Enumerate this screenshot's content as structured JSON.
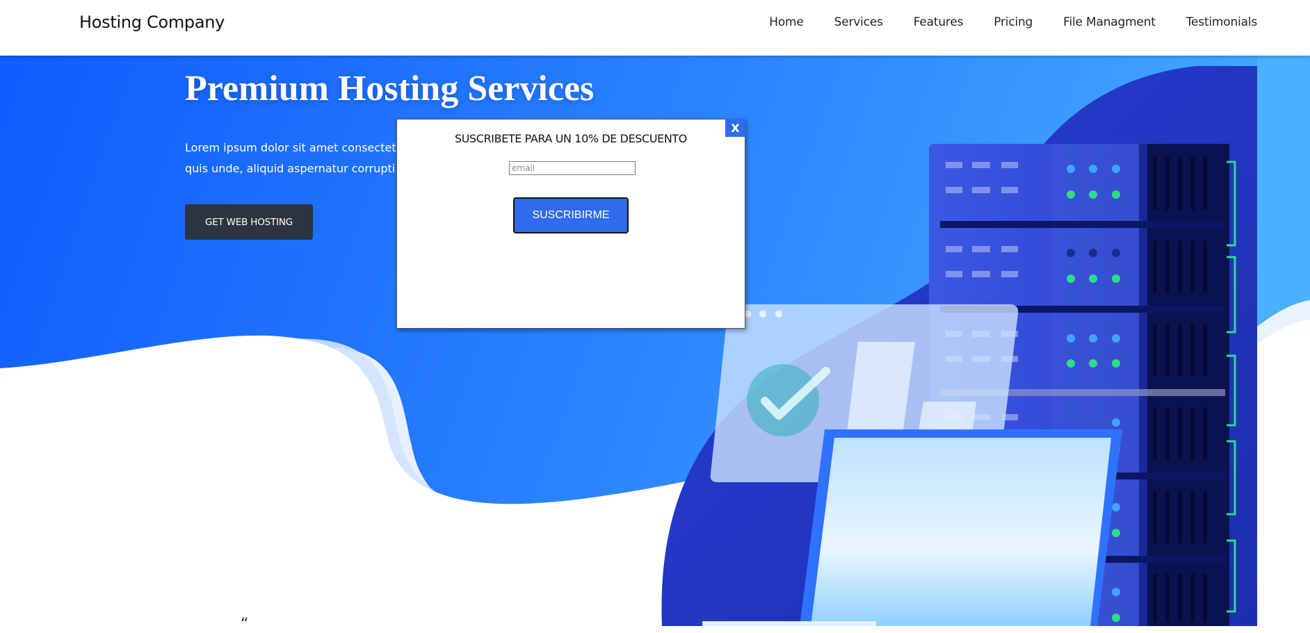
{
  "navbar": {
    "brand": "Hosting Company",
    "links": [
      {
        "label": "Home"
      },
      {
        "label": "Services"
      },
      {
        "label": "Features"
      },
      {
        "label": "Pricing"
      },
      {
        "label": "File Managment"
      },
      {
        "label": "Testimonials"
      }
    ]
  },
  "hero": {
    "title": "Premium Hosting Services",
    "text_line1": "Lorem ipsum dolor sit amet consectetur adipisicing elit.",
    "text_line2": "quis unde, aliquid aspernatur corrupti.",
    "cta_label": "GET WEB HOSTING"
  },
  "modal": {
    "close_label": "X",
    "title": "SUSCRIBETE PARA UN 10% DE DESCUENTO",
    "email_placeholder": "email",
    "email_value": "",
    "submit_label": "SUSCRIBIRME"
  },
  "below_fold": {
    "cut_text": "“"
  },
  "colors": {
    "hero_blue": "#1565fb",
    "hero_light_blue": "#4aaeff",
    "cta_dark": "#2c3440",
    "modal_button": "#2f6bec",
    "server_dark": "#0c1560",
    "led_blue": "#3fa3ff",
    "led_green": "#2edb8b"
  }
}
